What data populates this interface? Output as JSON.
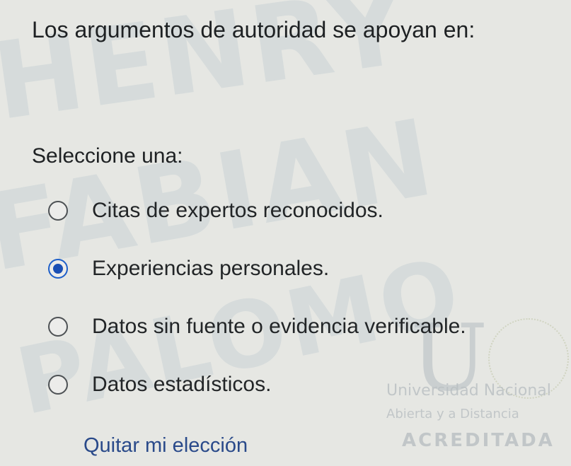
{
  "question": {
    "text": "Los argumentos de autoridad se apoyan en:"
  },
  "select_label": "Seleccione una:",
  "options": [
    {
      "label": "Citas de expertos reconocidos.",
      "selected": false
    },
    {
      "label": "Experiencias personales.",
      "selected": true
    },
    {
      "label": "Datos sin fuente o evidencia verificable.",
      "selected": false
    },
    {
      "label": "Datos estadísticos.",
      "selected": false
    }
  ],
  "clear_choice_label": "Quitar mi elección",
  "watermarks": {
    "line1": "HENRY",
    "line2": "FABIAN",
    "line3": "PALOMO",
    "seal_letter": "U",
    "seal_line1": "Universidad Nacional",
    "seal_line2": "Abierta y a Distancia",
    "seal_line3": "ACREDITADA"
  },
  "colors": {
    "background": "#e6e7e3",
    "text": "#1f2224",
    "accent": "#1a4fb4",
    "link": "#2a4a8a"
  }
}
